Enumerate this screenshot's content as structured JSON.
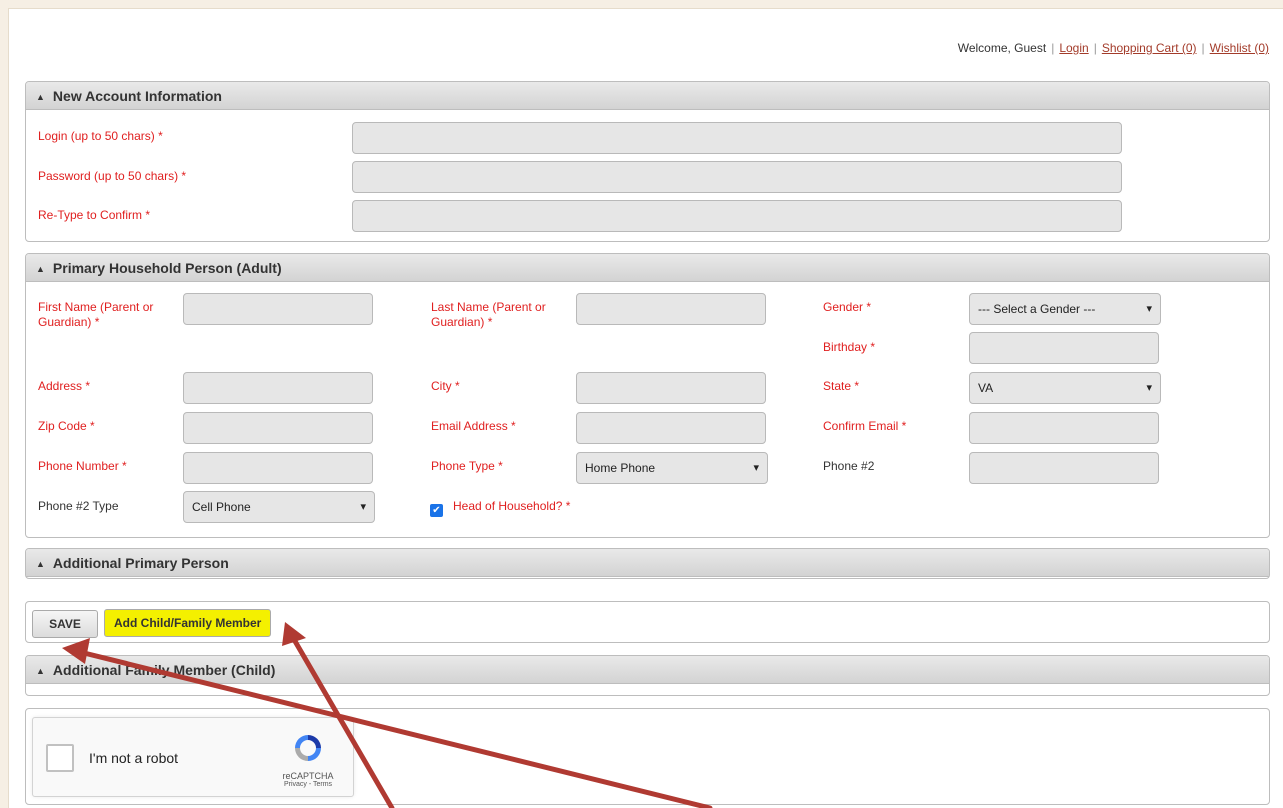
{
  "topbar": {
    "welcome": "Welcome, Guest",
    "login": "Login",
    "cart": "Shopping Cart (0)",
    "wishlist": "Wishlist (0)"
  },
  "account": {
    "title": "New Account Information",
    "login_label": "Login (up to 50 chars) *",
    "password_label": "Password (up to 50 chars) *",
    "retype_label": "Re-Type to Confirm *"
  },
  "primary": {
    "title": "Primary Household Person (Adult)",
    "first_name_label": "First Name (Parent or Guardian) *",
    "last_name_label": "Last Name (Parent or Guardian) *",
    "gender_label": "Gender *",
    "gender_value": "--- Select a Gender ---",
    "birthday_label": "Birthday *",
    "address_label": "Address *",
    "city_label": "City *",
    "state_label": "State *",
    "state_value": "VA",
    "zip_label": "Zip Code *",
    "email_label": "Email Address *",
    "confirm_email_label": "Confirm Email *",
    "phone_label": "Phone Number *",
    "phone_type_label": "Phone Type *",
    "phone_type_value": "Home Phone",
    "phone2_label": "Phone #2",
    "phone2_type_label": "Phone #2 Type",
    "phone2_type_value": "Cell Phone",
    "head_label": "Head of Household? *",
    "head_checked": true
  },
  "additional_primary": {
    "title": "Additional Primary Person"
  },
  "actions": {
    "save": "SAVE",
    "add_child": "Add Child/Family Member"
  },
  "additional_child": {
    "title": "Additional Family Member (Child)"
  },
  "captcha": {
    "label": "I'm not a robot",
    "brand": "reCAPTCHA",
    "links": "Privacy - Terms"
  },
  "colors": {
    "required": "#e02020",
    "link": "#a33b2a",
    "highlight": "#f4f000",
    "arrow": "#b03a32"
  }
}
